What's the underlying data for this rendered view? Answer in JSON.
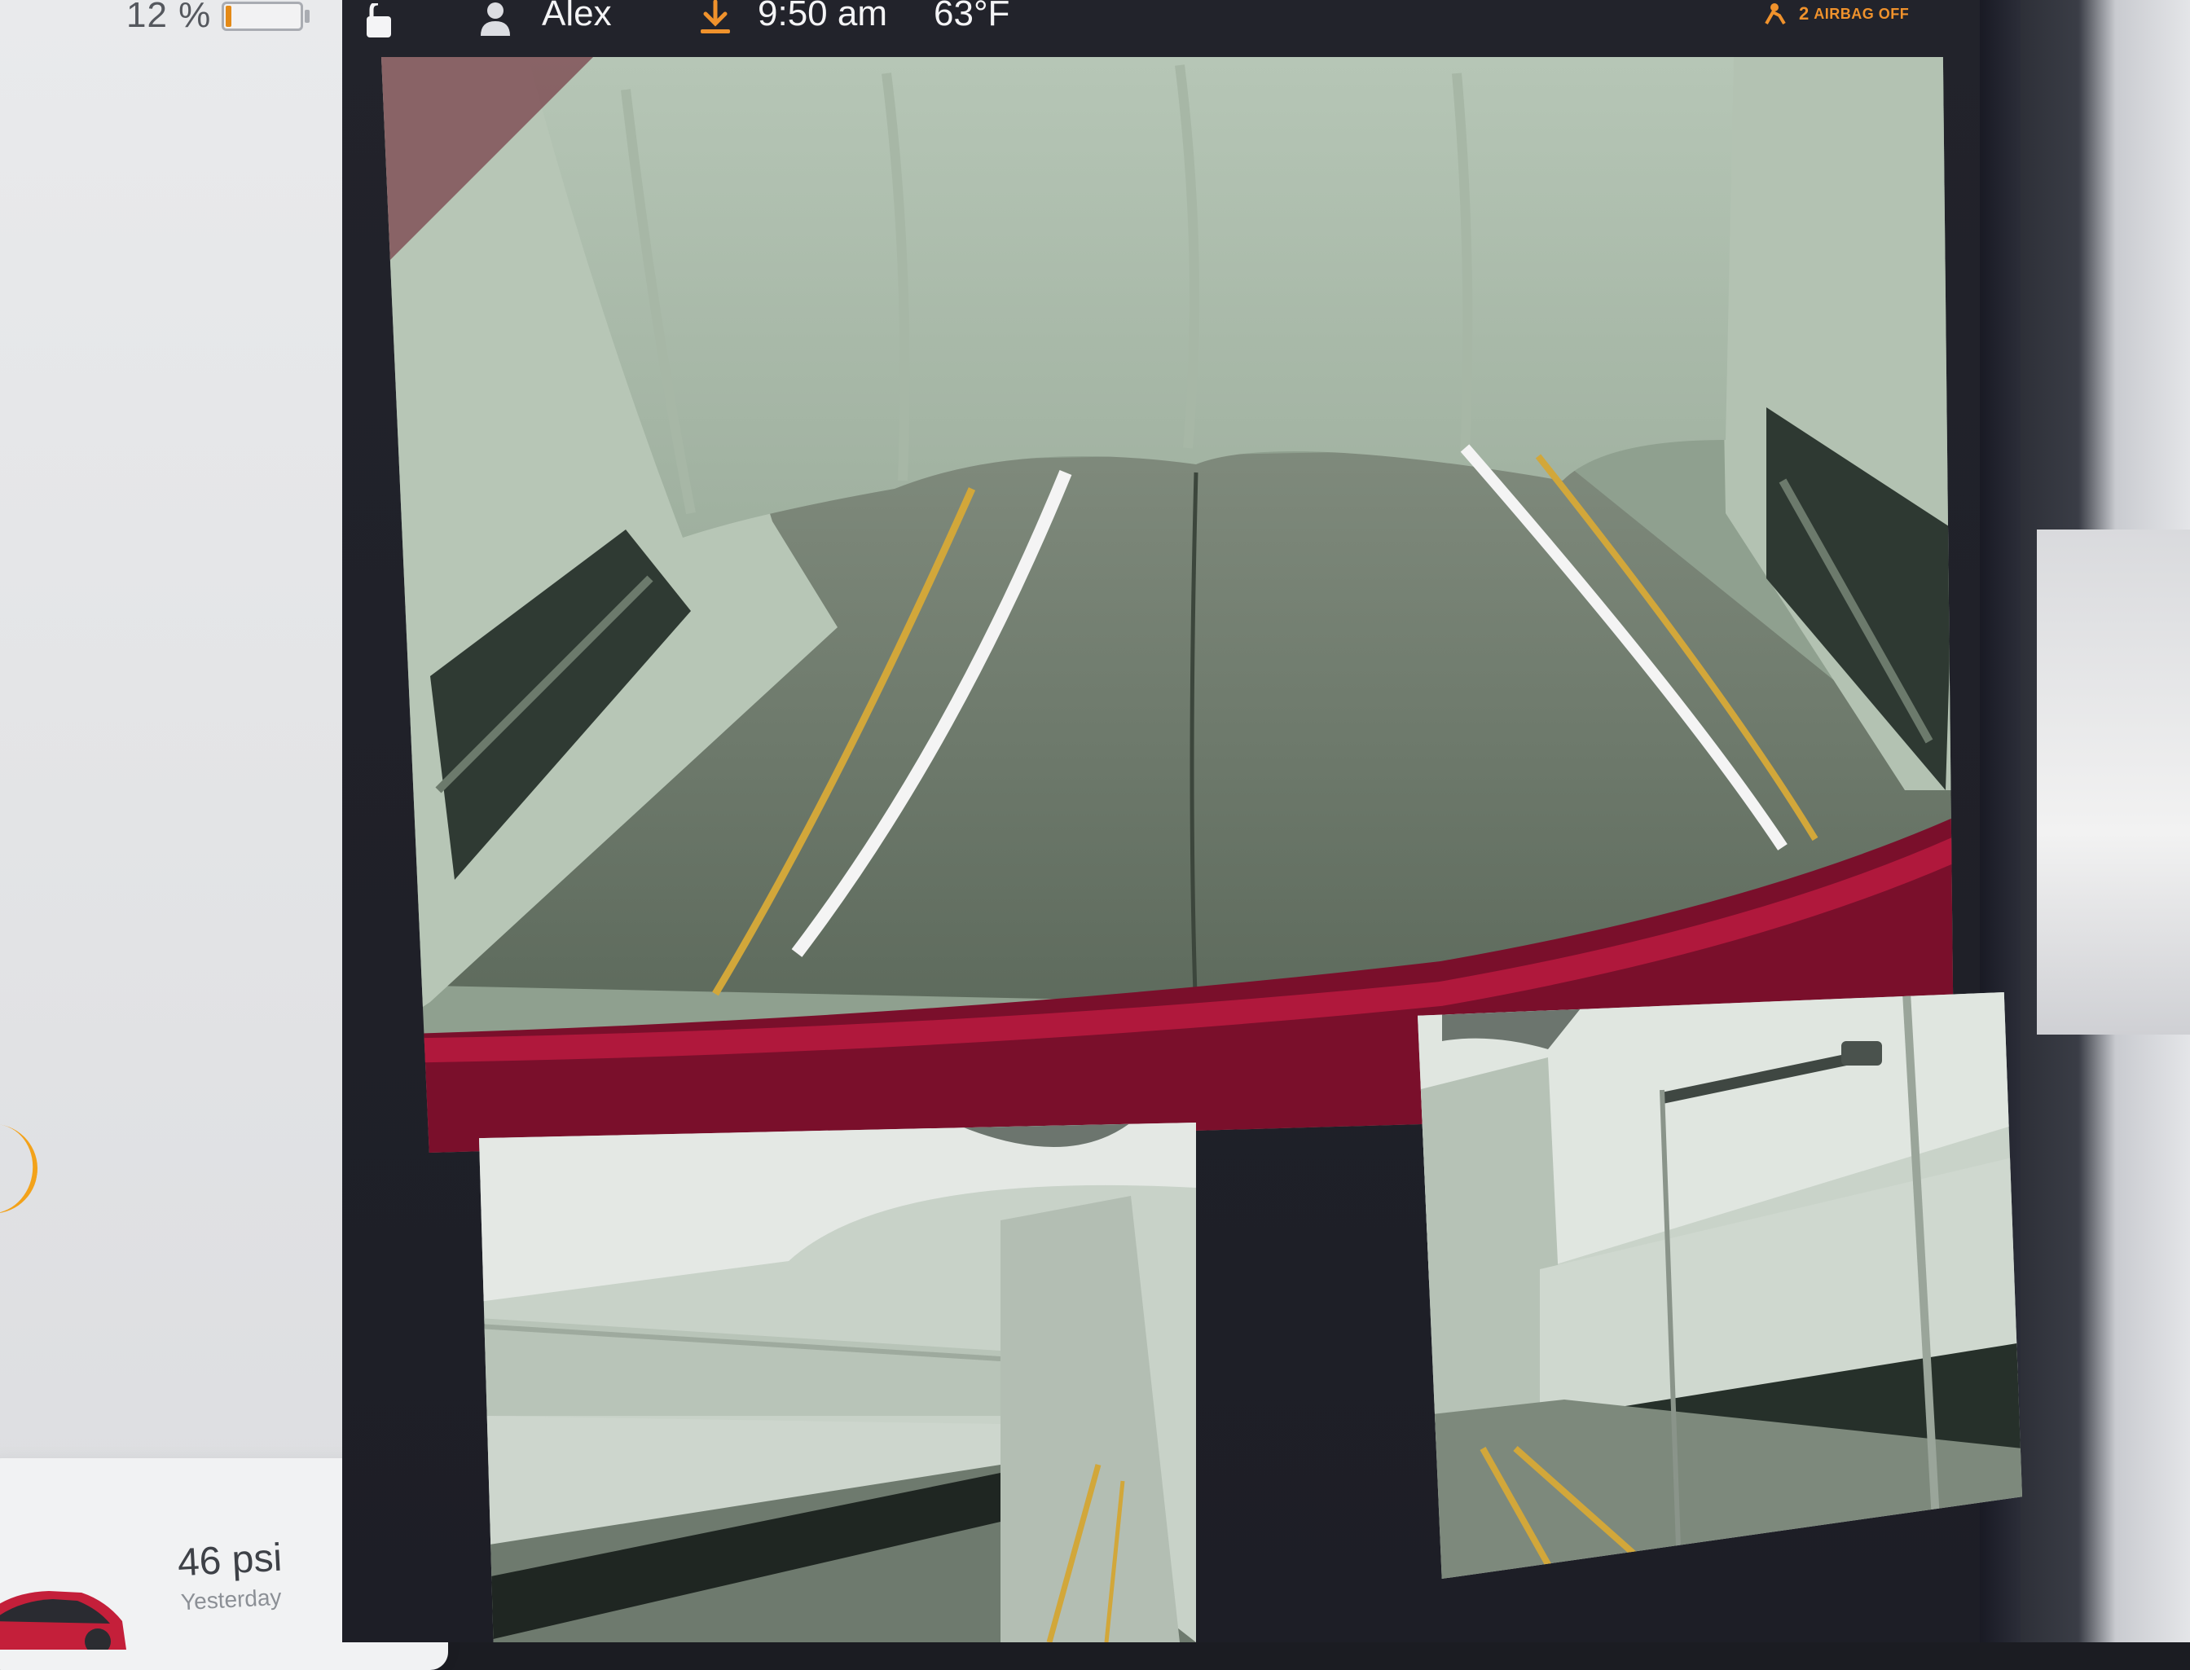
{
  "status_bar": {
    "battery_percent_text": "12 %",
    "battery_level": 0.12,
    "user_name": "Alex",
    "time": "9:50 am",
    "temperature": "63°F",
    "airbag_seat": "2",
    "airbag_status": "AIRBAG OFF"
  },
  "tire_card": {
    "pressure": "46 psi",
    "updated": "Yesterday"
  },
  "camera_views": {
    "rear": "rear-camera",
    "left_repeater": "left-repeater-camera",
    "right_repeater": "right-repeater-camera"
  },
  "icons": [
    "lock-open-icon",
    "user-icon",
    "download-icon",
    "airbag-off-icon"
  ],
  "colors": {
    "accent_orange": "#f0922c",
    "battery_fill": "#e48a17",
    "screen_dark": "#1d1e26",
    "car_red": "#b0183c",
    "guide_yellow": "#d2a73a",
    "guide_white": "#f4f4f4"
  }
}
